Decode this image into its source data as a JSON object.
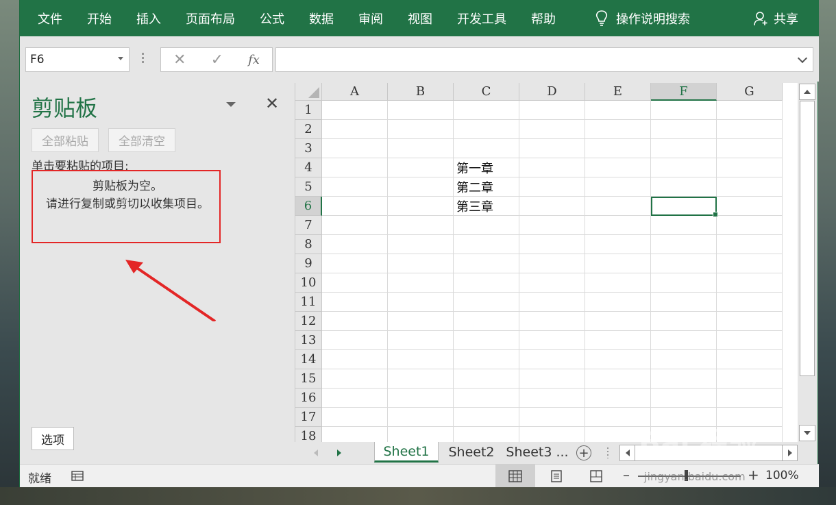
{
  "ribbon": {
    "tabs": [
      "文件",
      "开始",
      "插入",
      "页面布局",
      "公式",
      "数据",
      "审阅",
      "视图",
      "开发工具",
      "帮助"
    ],
    "tell_me": "操作说明搜索",
    "share": "共享",
    "color": "#217346"
  },
  "formula_bar": {
    "name_box": "F6",
    "fx_label": "fx",
    "formula": ""
  },
  "clipboard_pane": {
    "title": "剪贴板",
    "paste_all": "全部粘贴",
    "clear_all": "全部清空",
    "hint": "单击要粘贴的项目:",
    "empty_line1": "剪贴板为空。",
    "empty_line2": "请进行复制或剪切以收集项目。",
    "options": "选项"
  },
  "grid": {
    "columns": [
      "A",
      "B",
      "C",
      "D",
      "E",
      "F",
      "G"
    ],
    "rows": [
      "1",
      "2",
      "3",
      "4",
      "5",
      "6",
      "7",
      "8",
      "9",
      "10",
      "11",
      "12",
      "13",
      "14",
      "15",
      "16",
      "17",
      "18"
    ],
    "active_column": "F",
    "active_row": "6",
    "cells": {
      "C4": "第一章",
      "C5": "第二章",
      "C6": "第三章"
    }
  },
  "sheet_tabs": {
    "tabs": [
      "Sheet1",
      "Sheet2",
      "Sheet3 ..."
    ],
    "active": "Sheet1"
  },
  "status": {
    "ready": "就绪",
    "zoom": "100%"
  },
  "watermark": {
    "brand": "Bai 经验",
    "url": "jingyan.baidu.com"
  }
}
